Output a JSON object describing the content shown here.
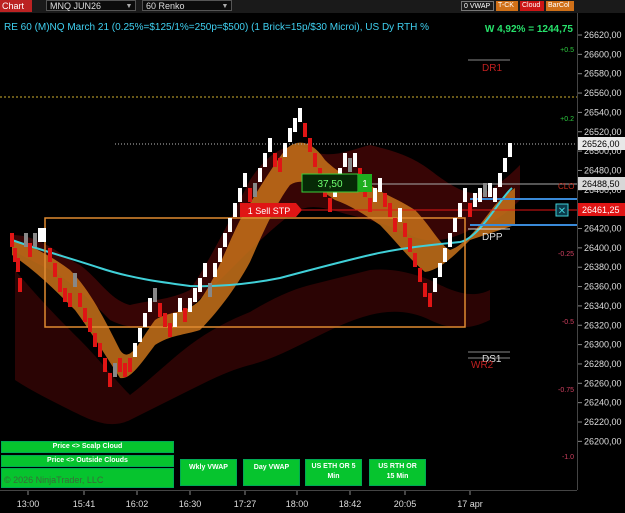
{
  "toolbar": {
    "tab_label": "Chart",
    "instrument": "MNQ JUN26",
    "period": "60 Renko",
    "btn_vwap": "0 VWAP",
    "btn_tck": "T-CK",
    "btn_cloud": "Cloud",
    "btn_barcol": "BarCol"
  },
  "chart": {
    "title": "RE 60 (M)NQ March 21 (0.25%=$125/1%=250p=$500) (1 Brick=15p/$30 Microi), US Dy RTH %",
    "performance": "W 4,92% = 1244,75",
    "labels": {
      "dr1": "DR1",
      "ds1": "DS1",
      "wr2": "WR2",
      "dpp": "DPP",
      "clo": "CLO",
      "sell_stop": "1 Sell STP",
      "order_price": "37,50",
      "order_qty": "1",
      "close_x": "✕"
    },
    "percent_labels": [
      "+0.5",
      "+0.2",
      "-0.25",
      "-0.5",
      "-0.75",
      "-1.0"
    ],
    "buttons": {
      "scalp_cloud": "Price <> Scalp Cloud",
      "outside_clouds": "Price <> Outside Clouds",
      "wkly_vwap": "Wkly VWAP",
      "day_vwap": "Day VWAP",
      "us_eth_line1": "US ETH OR 5",
      "us_eth_line2": "Min",
      "us_rth_line1": "US RTH OR",
      "us_rth_line2": "15 Min"
    },
    "copyright": "© 2026 NinjaTrader, LLC"
  },
  "y_axis": {
    "ticks": [
      "26620,00",
      "26600,00",
      "26580,00",
      "26560,00",
      "26540,00",
      "26520,00",
      "26500,00",
      "26480,00",
      "26460,00",
      "26440,00",
      "26420,00",
      "26400,00",
      "26380,00",
      "26360,00",
      "26340,00",
      "26320,00",
      "26300,00",
      "26280,00",
      "26260,00",
      "26240,00",
      "26220,00",
      "26200,00"
    ],
    "price_tags": {
      "dotted": "26526,00",
      "close": "26488,50",
      "sell": "26461,25"
    }
  },
  "x_axis": {
    "ticks": [
      "13:00",
      "15:41",
      "16:02",
      "16:30",
      "17:27",
      "18:00",
      "18:42",
      "20:05",
      "17 apr"
    ]
  },
  "colors": {
    "up_brick": "#ffffff",
    "down_brick": "#e01515",
    "neutral_brick": "#888888",
    "cloud_orange": "#c8721a",
    "cloud_red": "#4a0808",
    "vwap": "#40d0d8",
    "box_outline": "#e08a30",
    "button_green": "#06c42e",
    "title_cyan": "#3fd0f0"
  }
}
